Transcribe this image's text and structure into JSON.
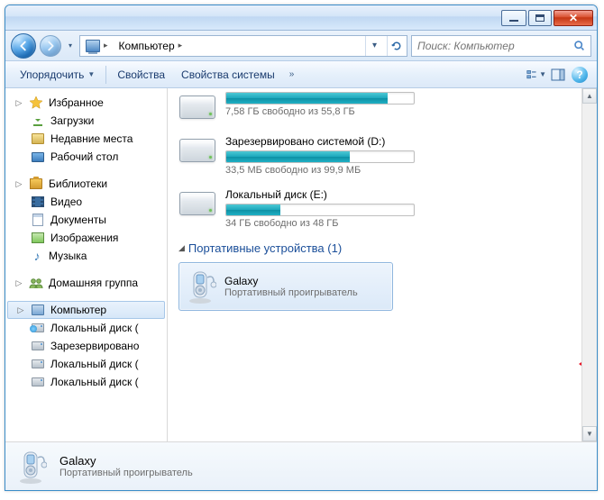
{
  "address": {
    "root_icon": "computer",
    "crumb": "Компьютер"
  },
  "search": {
    "placeholder": "Поиск: Компьютер"
  },
  "toolbar": {
    "organize": "Упорядочить",
    "properties": "Свойства",
    "system_properties": "Свойства системы",
    "more": "»"
  },
  "sidebar": {
    "favorites": {
      "label": "Избранное",
      "items": [
        "Загрузки",
        "Недавние места",
        "Рабочий стол"
      ]
    },
    "libraries": {
      "label": "Библиотеки",
      "items": [
        "Видео",
        "Документы",
        "Изображения",
        "Музыка"
      ]
    },
    "homegroup": {
      "label": "Домашняя группа"
    },
    "computer": {
      "label": "Компьютер",
      "items": [
        "Локальный диск (",
        "Зарезервировано",
        "Локальный диск (",
        "Локальный диск ("
      ]
    }
  },
  "drives": [
    {
      "free_text": "7,58 ГБ свободно из 55,8 ГБ",
      "fill_pct": 86
    },
    {
      "name": "Зарезервировано системой (D:)",
      "free_text": "33,5 МБ свободно из 99,9 МБ",
      "fill_pct": 66
    },
    {
      "name": "Локальный диск (E:)",
      "free_text": "34 ГБ свободно из 48 ГБ",
      "fill_pct": 29
    }
  ],
  "category": {
    "label": "Портативные устройства (1)"
  },
  "device": {
    "name": "Galaxy",
    "subtitle": "Портативный проигрыватель"
  },
  "details": {
    "name": "Galaxy",
    "subtitle": "Портативный проигрыватель"
  }
}
